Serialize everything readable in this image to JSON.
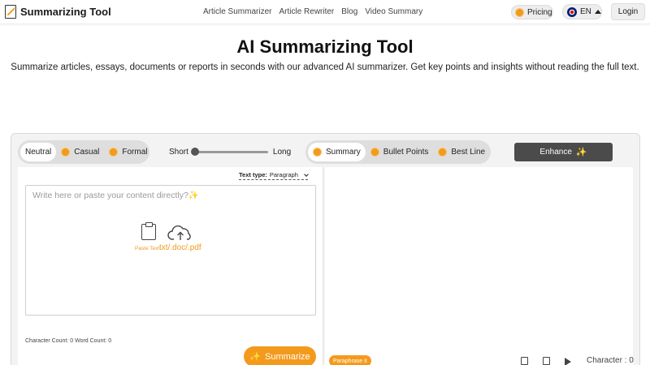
{
  "header": {
    "logo_text": "Summarizing Tool",
    "nav": [
      "Article Summarizer",
      "Article Rewriter",
      "Blog",
      "Video Summary"
    ],
    "pricing_label": "Pricing",
    "language_label": "EN",
    "login_label": "Login"
  },
  "hero": {
    "title": "AI Summarizing Tool",
    "subtitle": "Summarize articles, essays, documents or reports in seconds with our advanced AI summarizer. Get key points and insights without reading the full text."
  },
  "toolbar": {
    "tones": [
      {
        "label": "Neutral",
        "active": true
      },
      {
        "label": "Casual",
        "active": false
      },
      {
        "label": "Formal",
        "active": false
      }
    ],
    "length_min_label": "Short",
    "length_max_label": "Long",
    "length_value": 0,
    "modes": [
      {
        "label": "Summary",
        "active": true
      },
      {
        "label": "Bullet Points",
        "active": false
      },
      {
        "label": "Best Line",
        "active": false
      }
    ],
    "enhance_label": "Enhance"
  },
  "input": {
    "text_type_label": "Text type:",
    "text_type_value": "Paragraph",
    "placeholder": "Write here or paste your content directly?",
    "paste_label": "Paste Text",
    "upload_label": "txt/.doc/.pdf",
    "counts_text": "Character Count: 0 Word Count: 0",
    "summarize_label": "Summarize"
  },
  "output": {
    "paraphrase_label": "Paraphrase it",
    "character_label": "Character : 0"
  },
  "colors": {
    "accent": "#f39a1d",
    "enhance_bg": "#4b4b4b"
  }
}
